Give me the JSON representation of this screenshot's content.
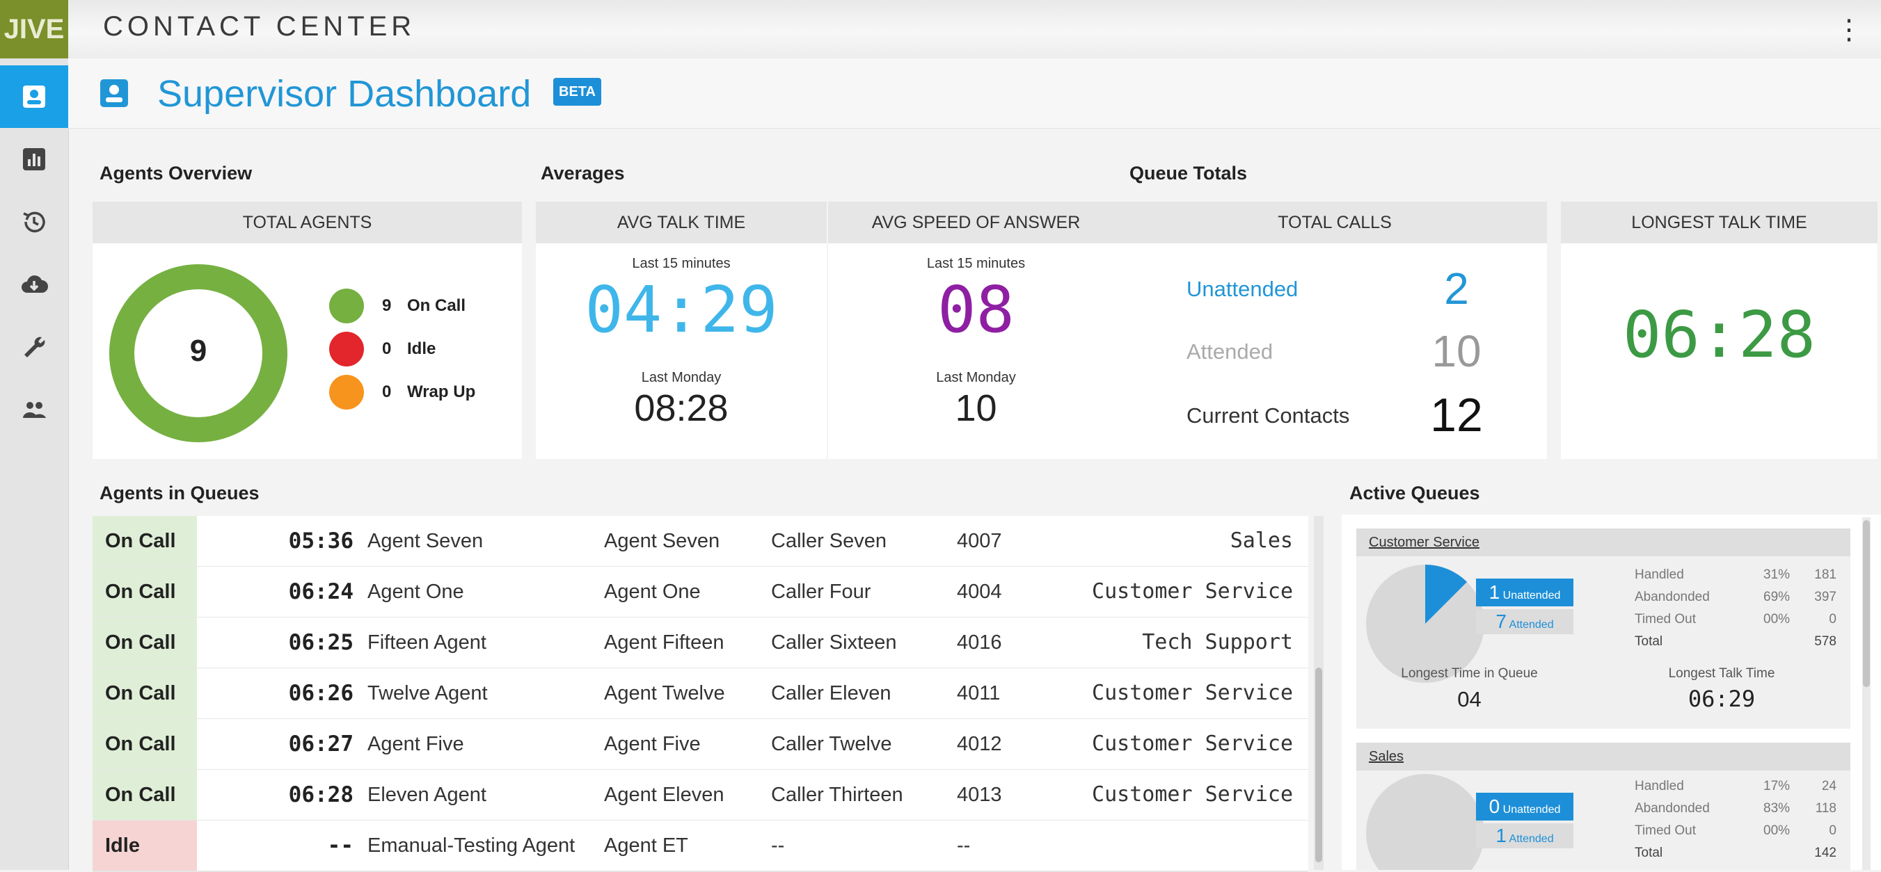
{
  "app": {
    "logo": "JIVE",
    "title": "CONTACT CENTER"
  },
  "sidebar": {
    "items": [
      "dashboard",
      "reports",
      "history",
      "download",
      "settings",
      "users"
    ]
  },
  "page": {
    "title": "Supervisor Dashboard",
    "badge": "BETA"
  },
  "sections": {
    "agents_overview": "Agents Overview",
    "averages": "Averages",
    "queue_totals": "Queue Totals",
    "agents_in_queues": "Agents in Queues",
    "active_queues": "Active Queues"
  },
  "total_agents": {
    "header": "TOTAL AGENTS",
    "count": "9",
    "legend": [
      {
        "count": "9",
        "label": "On Call",
        "color": "#76b041"
      },
      {
        "count": "0",
        "label": "Idle",
        "color": "#e2262b"
      },
      {
        "count": "0",
        "label": "Wrap Up",
        "color": "#f7941d"
      }
    ]
  },
  "avg_talk_time": {
    "header": "AVG TALK TIME",
    "period1": "Last 15 minutes",
    "value1": "04:29",
    "period2": "Last Monday",
    "value2": "08:28",
    "color": "#3fb6ea"
  },
  "avg_speed_answer": {
    "header": "AVG SPEED OF ANSWER",
    "period1": "Last 15 minutes",
    "value1": "08",
    "period2": "Last Monday",
    "value2": "10",
    "color": "#8e1fa3"
  },
  "total_calls": {
    "header": "TOTAL CALLS",
    "rows": [
      {
        "label": "Unattended",
        "value": "2"
      },
      {
        "label": "Attended",
        "value": "10"
      },
      {
        "label": "Current Contacts",
        "value": "12"
      }
    ]
  },
  "longest_talk_time": {
    "header": "LONGEST TALK TIME",
    "value": "06:28",
    "color": "#3c9a44"
  },
  "agents_in_queues": {
    "rows": [
      {
        "status": "On Call",
        "time": "05:36",
        "agent": "Agent Seven",
        "agent2": "Agent Seven",
        "caller": "Caller Seven",
        "ext": "4007",
        "queue": "Sales"
      },
      {
        "status": "On Call",
        "time": "06:24",
        "agent": "Agent One",
        "agent2": "Agent One",
        "caller": "Caller Four",
        "ext": "4004",
        "queue": "Customer Service"
      },
      {
        "status": "On Call",
        "time": "06:25",
        "agent": "Fifteen Agent",
        "agent2": "Agent Fifteen",
        "caller": "Caller Sixteen",
        "ext": "4016",
        "queue": "Tech Support"
      },
      {
        "status": "On Call",
        "time": "06:26",
        "agent": "Twelve Agent",
        "agent2": "Agent Twelve",
        "caller": "Caller Eleven",
        "ext": "4011",
        "queue": "Customer Service"
      },
      {
        "status": "On Call",
        "time": "06:27",
        "agent": "Agent Five",
        "agent2": "Agent Five",
        "caller": "Caller Twelve",
        "ext": "4012",
        "queue": "Customer Service"
      },
      {
        "status": "On Call",
        "time": "06:28",
        "agent": "Eleven Agent",
        "agent2": "Agent Eleven",
        "caller": "Caller Thirteen",
        "ext": "4013",
        "queue": "Customer Service"
      },
      {
        "status": "Idle",
        "time": "--",
        "agent": "Emanual-Testing Agent",
        "agent2": "Agent ET",
        "caller": "--",
        "ext": "--",
        "queue": ""
      }
    ]
  },
  "active_queues": [
    {
      "name": "Customer Service",
      "unattended": "1",
      "unattended_label": "Unattended",
      "attended": "7",
      "attended_label": "Attended",
      "pie_fraction": 0.125,
      "stats": [
        {
          "label": "Handled",
          "pct": "31%",
          "count": "181"
        },
        {
          "label": "Abandonded",
          "pct": "69%",
          "count": "397"
        },
        {
          "label": "Timed Out",
          "pct": "00%",
          "count": "0"
        },
        {
          "label": "Total",
          "pct": "",
          "count": "578"
        }
      ],
      "longest_queue_label": "Longest Time in Queue",
      "longest_queue": "04",
      "longest_talk_label": "Longest Talk Time",
      "longest_talk": "06:29"
    },
    {
      "name": "Sales",
      "unattended": "0",
      "unattended_label": "Unattended",
      "attended": "1",
      "attended_label": "Attended",
      "pie_fraction": 0,
      "stats": [
        {
          "label": "Handled",
          "pct": "17%",
          "count": "24"
        },
        {
          "label": "Abandonded",
          "pct": "83%",
          "count": "118"
        },
        {
          "label": "Timed Out",
          "pct": "00%",
          "count": "0"
        },
        {
          "label": "Total",
          "pct": "",
          "count": "142"
        }
      ]
    }
  ]
}
